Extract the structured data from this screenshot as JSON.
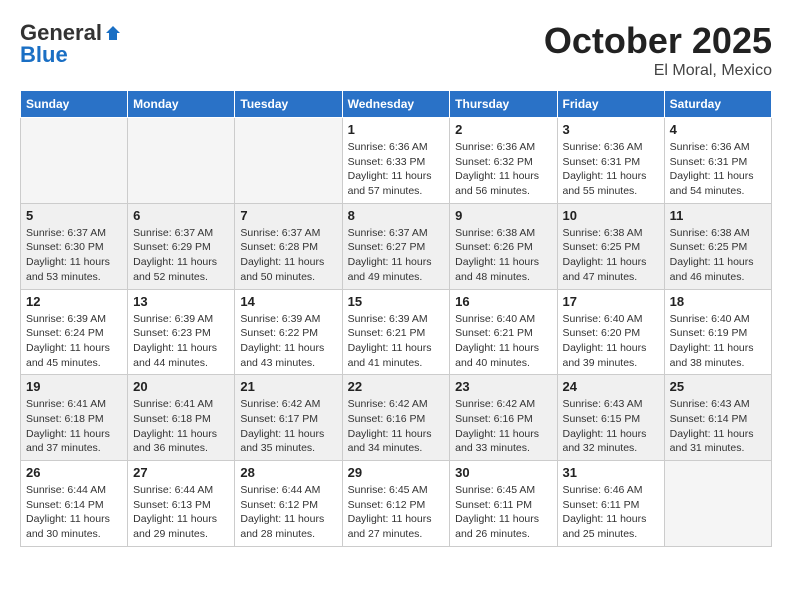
{
  "header": {
    "logo_general": "General",
    "logo_blue": "Blue",
    "month_title": "October 2025",
    "location": "El Moral, Mexico"
  },
  "weekdays": [
    "Sunday",
    "Monday",
    "Tuesday",
    "Wednesday",
    "Thursday",
    "Friday",
    "Saturday"
  ],
  "weeks": [
    [
      {
        "day": "",
        "empty": true
      },
      {
        "day": "",
        "empty": true
      },
      {
        "day": "",
        "empty": true
      },
      {
        "day": "1",
        "sunrise": "Sunrise: 6:36 AM",
        "sunset": "Sunset: 6:33 PM",
        "daylight": "Daylight: 11 hours and 57 minutes."
      },
      {
        "day": "2",
        "sunrise": "Sunrise: 6:36 AM",
        "sunset": "Sunset: 6:32 PM",
        "daylight": "Daylight: 11 hours and 56 minutes."
      },
      {
        "day": "3",
        "sunrise": "Sunrise: 6:36 AM",
        "sunset": "Sunset: 6:31 PM",
        "daylight": "Daylight: 11 hours and 55 minutes."
      },
      {
        "day": "4",
        "sunrise": "Sunrise: 6:36 AM",
        "sunset": "Sunset: 6:31 PM",
        "daylight": "Daylight: 11 hours and 54 minutes."
      }
    ],
    [
      {
        "day": "5",
        "sunrise": "Sunrise: 6:37 AM",
        "sunset": "Sunset: 6:30 PM",
        "daylight": "Daylight: 11 hours and 53 minutes."
      },
      {
        "day": "6",
        "sunrise": "Sunrise: 6:37 AM",
        "sunset": "Sunset: 6:29 PM",
        "daylight": "Daylight: 11 hours and 52 minutes."
      },
      {
        "day": "7",
        "sunrise": "Sunrise: 6:37 AM",
        "sunset": "Sunset: 6:28 PM",
        "daylight": "Daylight: 11 hours and 50 minutes."
      },
      {
        "day": "8",
        "sunrise": "Sunrise: 6:37 AM",
        "sunset": "Sunset: 6:27 PM",
        "daylight": "Daylight: 11 hours and 49 minutes."
      },
      {
        "day": "9",
        "sunrise": "Sunrise: 6:38 AM",
        "sunset": "Sunset: 6:26 PM",
        "daylight": "Daylight: 11 hours and 48 minutes."
      },
      {
        "day": "10",
        "sunrise": "Sunrise: 6:38 AM",
        "sunset": "Sunset: 6:25 PM",
        "daylight": "Daylight: 11 hours and 47 minutes."
      },
      {
        "day": "11",
        "sunrise": "Sunrise: 6:38 AM",
        "sunset": "Sunset: 6:25 PM",
        "daylight": "Daylight: 11 hours and 46 minutes."
      }
    ],
    [
      {
        "day": "12",
        "sunrise": "Sunrise: 6:39 AM",
        "sunset": "Sunset: 6:24 PM",
        "daylight": "Daylight: 11 hours and 45 minutes."
      },
      {
        "day": "13",
        "sunrise": "Sunrise: 6:39 AM",
        "sunset": "Sunset: 6:23 PM",
        "daylight": "Daylight: 11 hours and 44 minutes."
      },
      {
        "day": "14",
        "sunrise": "Sunrise: 6:39 AM",
        "sunset": "Sunset: 6:22 PM",
        "daylight": "Daylight: 11 hours and 43 minutes."
      },
      {
        "day": "15",
        "sunrise": "Sunrise: 6:39 AM",
        "sunset": "Sunset: 6:21 PM",
        "daylight": "Daylight: 11 hours and 41 minutes."
      },
      {
        "day": "16",
        "sunrise": "Sunrise: 6:40 AM",
        "sunset": "Sunset: 6:21 PM",
        "daylight": "Daylight: 11 hours and 40 minutes."
      },
      {
        "day": "17",
        "sunrise": "Sunrise: 6:40 AM",
        "sunset": "Sunset: 6:20 PM",
        "daylight": "Daylight: 11 hours and 39 minutes."
      },
      {
        "day": "18",
        "sunrise": "Sunrise: 6:40 AM",
        "sunset": "Sunset: 6:19 PM",
        "daylight": "Daylight: 11 hours and 38 minutes."
      }
    ],
    [
      {
        "day": "19",
        "sunrise": "Sunrise: 6:41 AM",
        "sunset": "Sunset: 6:18 PM",
        "daylight": "Daylight: 11 hours and 37 minutes."
      },
      {
        "day": "20",
        "sunrise": "Sunrise: 6:41 AM",
        "sunset": "Sunset: 6:18 PM",
        "daylight": "Daylight: 11 hours and 36 minutes."
      },
      {
        "day": "21",
        "sunrise": "Sunrise: 6:42 AM",
        "sunset": "Sunset: 6:17 PM",
        "daylight": "Daylight: 11 hours and 35 minutes."
      },
      {
        "day": "22",
        "sunrise": "Sunrise: 6:42 AM",
        "sunset": "Sunset: 6:16 PM",
        "daylight": "Daylight: 11 hours and 34 minutes."
      },
      {
        "day": "23",
        "sunrise": "Sunrise: 6:42 AM",
        "sunset": "Sunset: 6:16 PM",
        "daylight": "Daylight: 11 hours and 33 minutes."
      },
      {
        "day": "24",
        "sunrise": "Sunrise: 6:43 AM",
        "sunset": "Sunset: 6:15 PM",
        "daylight": "Daylight: 11 hours and 32 minutes."
      },
      {
        "day": "25",
        "sunrise": "Sunrise: 6:43 AM",
        "sunset": "Sunset: 6:14 PM",
        "daylight": "Daylight: 11 hours and 31 minutes."
      }
    ],
    [
      {
        "day": "26",
        "sunrise": "Sunrise: 6:44 AM",
        "sunset": "Sunset: 6:14 PM",
        "daylight": "Daylight: 11 hours and 30 minutes."
      },
      {
        "day": "27",
        "sunrise": "Sunrise: 6:44 AM",
        "sunset": "Sunset: 6:13 PM",
        "daylight": "Daylight: 11 hours and 29 minutes."
      },
      {
        "day": "28",
        "sunrise": "Sunrise: 6:44 AM",
        "sunset": "Sunset: 6:12 PM",
        "daylight": "Daylight: 11 hours and 28 minutes."
      },
      {
        "day": "29",
        "sunrise": "Sunrise: 6:45 AM",
        "sunset": "Sunset: 6:12 PM",
        "daylight": "Daylight: 11 hours and 27 minutes."
      },
      {
        "day": "30",
        "sunrise": "Sunrise: 6:45 AM",
        "sunset": "Sunset: 6:11 PM",
        "daylight": "Daylight: 11 hours and 26 minutes."
      },
      {
        "day": "31",
        "sunrise": "Sunrise: 6:46 AM",
        "sunset": "Sunset: 6:11 PM",
        "daylight": "Daylight: 11 hours and 25 minutes."
      },
      {
        "day": "",
        "empty": true
      }
    ]
  ]
}
